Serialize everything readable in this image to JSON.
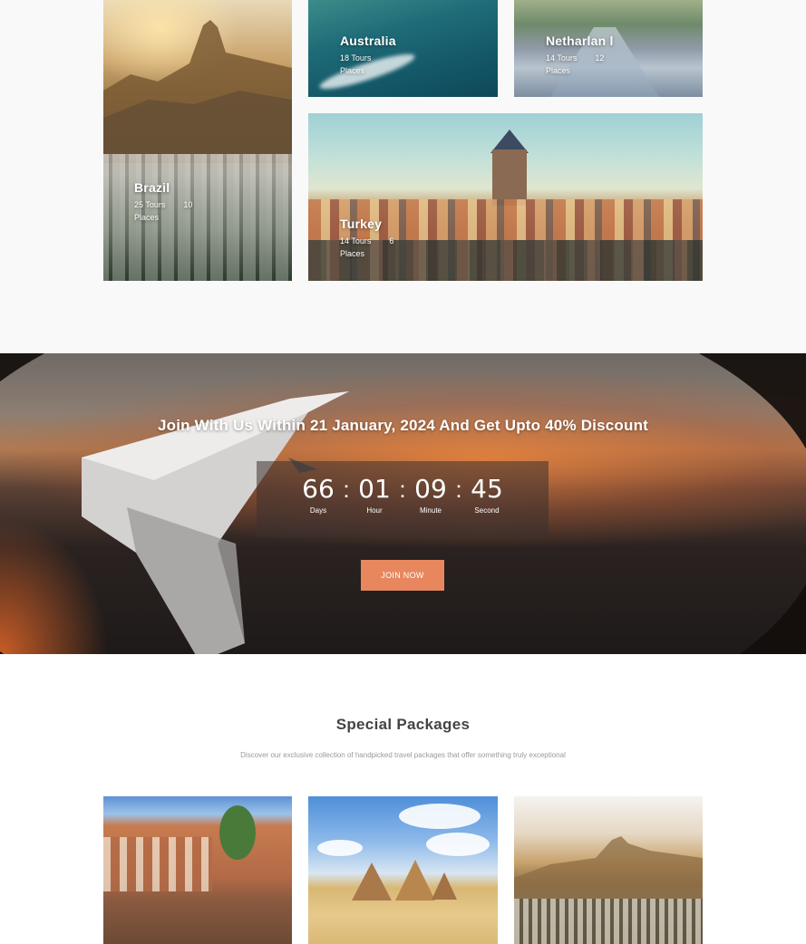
{
  "destinations": [
    {
      "id": "brazil",
      "name": "Brazil",
      "tours": "25 Tours",
      "places": "Places",
      "extra": "10"
    },
    {
      "id": "australia",
      "name": "Australia",
      "tours": "18 Tours",
      "places": "Places",
      "extra": ""
    },
    {
      "id": "netherland",
      "name": "Netharlan  l",
      "tours": "14 Tours",
      "places": "Places",
      "extra": "12"
    },
    {
      "id": "turkey",
      "name": "Turkey",
      "tours": "14 Tours",
      "places": "Places",
      "extra": "6"
    }
  ],
  "banner": {
    "title": "Join With Us Within 21 January, 2024 And Get Upto 40% Discount",
    "countdown": [
      {
        "value": "66",
        "label": "Days"
      },
      {
        "value": "01",
        "label": "Hour"
      },
      {
        "value": "09",
        "label": "Minute"
      },
      {
        "value": "45",
        "label": "Second"
      }
    ],
    "separator": ":",
    "button_label": "JOIN NOW"
  },
  "packages": {
    "title": "Special Packages",
    "subtitle": "Discover our exclusive collection of handpicked travel packages that offer something truly exceptional"
  },
  "colors": {
    "accent": "#e8875e",
    "page_bg": "#faf9fa"
  }
}
